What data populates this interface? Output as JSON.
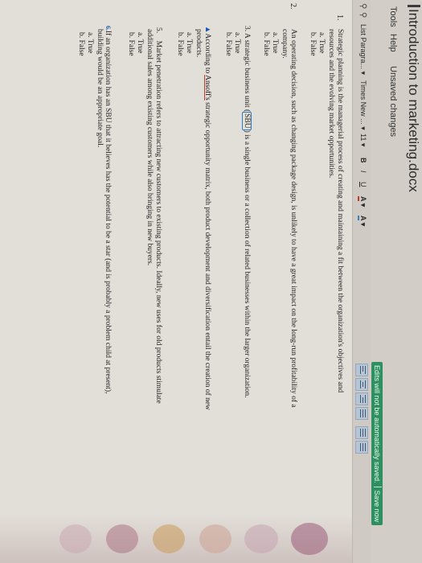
{
  "window": {
    "title": "Introduction to marketing.docx"
  },
  "menu": {
    "tools": "Tools",
    "help": "Help",
    "unsaved": "Unsaved changes"
  },
  "notice": {
    "message": "Edits will not be automatically saved.",
    "save_now": "Save now"
  },
  "toolbar": {
    "style": "List Paragra...",
    "font": "Times New ...",
    "size": "11",
    "bold": "B",
    "italic": "I",
    "underline": "U",
    "text_color": "A",
    "highlight": "A",
    "dropdown_arrow": "▾",
    "icons": [
      "search-icon",
      "zoom-icon"
    ]
  },
  "questions": [
    {
      "num": "1.",
      "text": "Strategic planning is the managerial process of creating and maintaining a fit between the organization's objectives and",
      "text2": "resources and the evolving market opportunities.",
      "options": [
        "a. True",
        "b. False"
      ]
    },
    {
      "num": "2.",
      "text": "An operating decision, such as changing package design, is unlikely to have a great impact on the long-run profitability of a",
      "text2": "company.",
      "options": [
        "a. True",
        "b. False"
      ]
    },
    {
      "num": "3.",
      "text_pre": "A strategic business unit (",
      "text_boxed": "SBU",
      "text_post": ") is a single business or a collection of related businesses within the larger organization.",
      "options": [
        "a. True",
        "b. False"
      ]
    },
    {
      "num": "4.",
      "text_pre": "According to ",
      "text_ul": "Ansoff's",
      "text_post": " strategic opportunity matrix, both product development and diversification entail the creation of new",
      "text2": "products.",
      "options": [
        "a. True",
        "b. False"
      ]
    },
    {
      "num": "5.",
      "text": "Market penetration refers to attracting new customers to existing products. Ideally, new uses for old products stimulate",
      "text2": "additional sales among existing customers while also bringing in new buyers.",
      "options": [
        "a. True",
        "b. False"
      ]
    },
    {
      "num": "6.",
      "text": "If an organization has an SBU that it believes has the potential to be a star (and is probably a problem child at present),",
      "text2": "building would be an appropriate goal.",
      "options": [
        "a. True",
        "b. False"
      ]
    }
  ],
  "colors": {
    "notice_bg": "#2e8f61",
    "text_color_underline": "#c23a2b",
    "highlight_underline": "#3a7fc2"
  }
}
